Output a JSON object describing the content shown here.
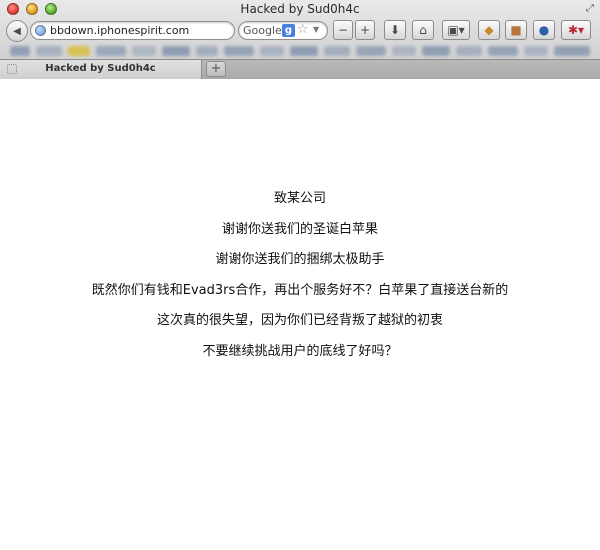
{
  "window": {
    "title": "Hacked by Sud0h4c"
  },
  "toolbar": {
    "back_icon": "◀",
    "url": "bbdown.iphonespirit.com",
    "search_provider": "Google",
    "google_badge": "g",
    "star_icon": "☆",
    "dropdown_icon": "▼",
    "zoom_out_label": "−",
    "zoom_in_label": "+",
    "download_icon": "⬇",
    "home_icon": "⌂",
    "view_icon": "▣▾",
    "ext_icon_1": "◆",
    "ext_icon_2": "■",
    "ext_icon_3": "●",
    "ext_icon_4": "✱▾",
    "fullscreen_icon": "⤢"
  },
  "tabs": {
    "active_label": "Hacked by Sud0h4c",
    "new_tab_label": "+"
  },
  "message": {
    "lines": [
      "致某公司",
      "谢谢你送我们的圣诞白苹果",
      "谢谢你送我们的捆绑太极助手",
      "既然你们有钱和Evad3rs合作，再出个服务好不？白苹果了直接送台新的",
      "这次真的很失望，因为你们已经背叛了越狱的初衷",
      "不要继续挑战用户的底线了好吗？"
    ]
  },
  "colors": {
    "chrome_top": "#e9e9e9",
    "chrome_bottom": "#c9c9c9",
    "page_background": "#ffffff",
    "text": "#111111"
  }
}
